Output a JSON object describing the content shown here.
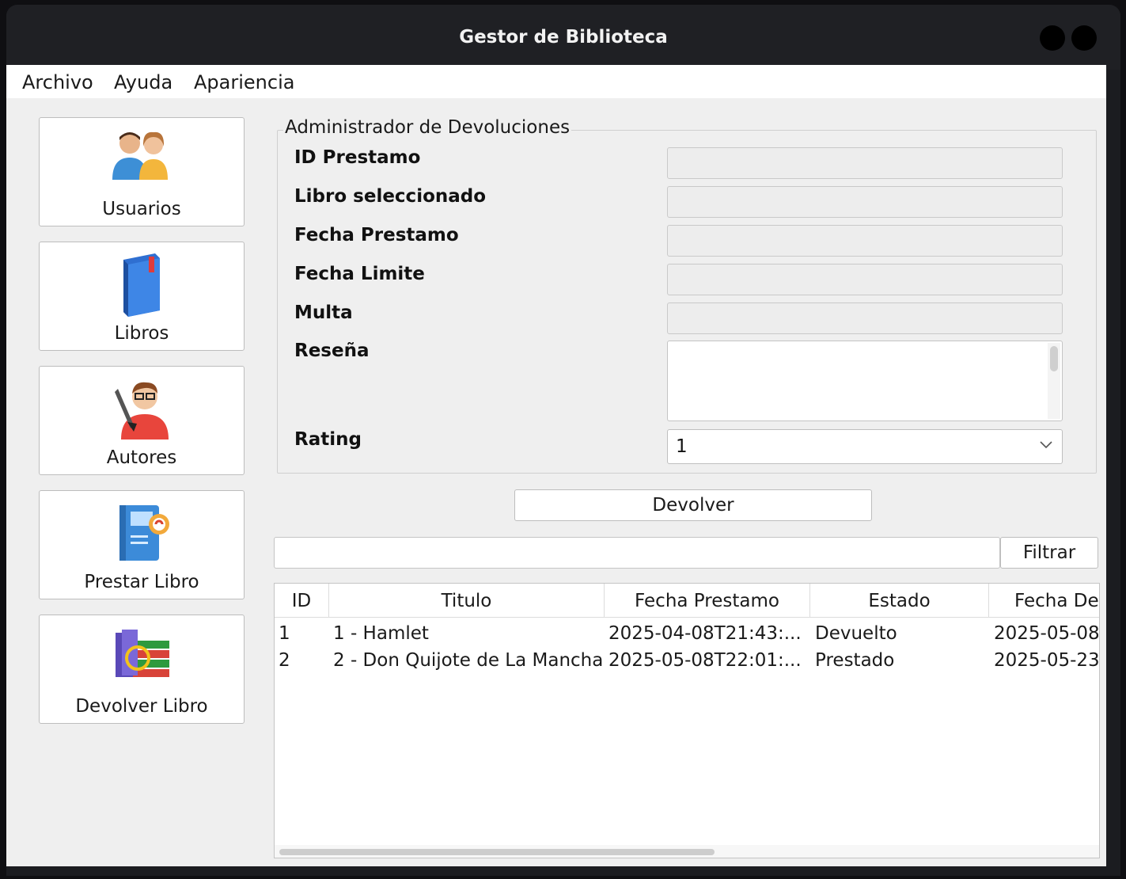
{
  "window": {
    "title": "Gestor de Biblioteca"
  },
  "menu": {
    "items": [
      "Archivo",
      "Ayuda",
      "Apariencia"
    ]
  },
  "sidebar": {
    "items": [
      {
        "label": "Usuarios",
        "icon": "users-icon"
      },
      {
        "label": "Libros",
        "icon": "book-icon"
      },
      {
        "label": "Autores",
        "icon": "author-icon"
      },
      {
        "label": "Prestar Libro",
        "icon": "lend-book-icon"
      },
      {
        "label": "Devolver Libro",
        "icon": "return-book-icon"
      }
    ]
  },
  "form": {
    "group_title": "Administrador de Devoluciones",
    "labels": {
      "id_prestamo": "ID Prestamo",
      "libro": "Libro seleccionado",
      "fecha_prestamo": "Fecha Prestamo",
      "fecha_limite": "Fecha Limite",
      "multa": "Multa",
      "resena": "Reseña",
      "rating": "Rating"
    },
    "rating_value": "1",
    "submit_label": "Devolver"
  },
  "filter": {
    "button_label": "Filtrar",
    "value": ""
  },
  "table": {
    "columns": [
      "ID",
      "Titulo",
      "Fecha Prestamo",
      "Estado",
      "Fecha De"
    ],
    "rows": [
      [
        "1",
        "1 - Hamlet",
        "2025-04-08T21:43:...",
        "Devuelto",
        "2025-05-08"
      ],
      [
        "2",
        "2 - Don Quijote de La Mancha",
        "2025-05-08T22:01:...",
        "Prestado",
        "2025-05-23"
      ]
    ]
  }
}
